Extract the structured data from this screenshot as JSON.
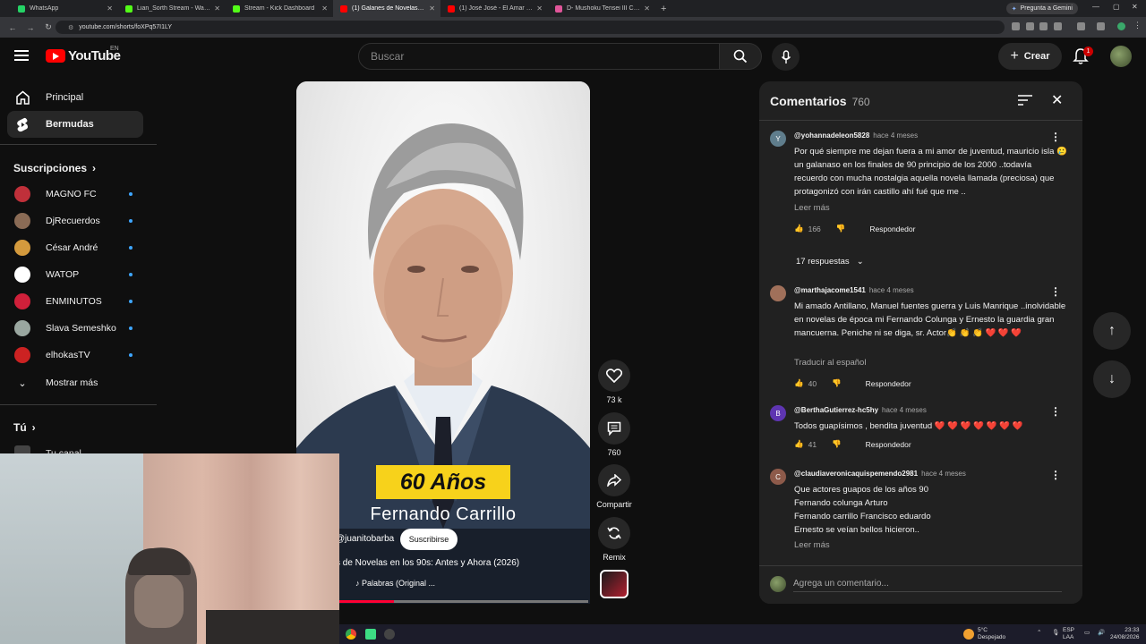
{
  "browser": {
    "tabs": [
      {
        "title": "WhatsApp",
        "color": "#25d366",
        "active": false
      },
      {
        "title": "Lian_Sorth Stream - Watch Live",
        "color": "#53fc18",
        "active": false
      },
      {
        "title": "Stream - Kick Dashboard",
        "color": "#53fc18",
        "active": false
      },
      {
        "title": "(1) Galanes de Novelas en",
        "color": "#ff0000",
        "active": true
      },
      {
        "title": "(1) José José - El Amar y el",
        "color": "#ff0000",
        "active": false
      },
      {
        "title": "D- Mushoku Tensei III Cap",
        "color": "#e05599",
        "active": false
      }
    ],
    "gemini_label": "Pregunta a Gemini",
    "url": "youtube.com/shorts/foXPq57I1LY"
  },
  "header": {
    "logo_text": "YouTube",
    "country_code": "EN",
    "search_placeholder": "Buscar",
    "create_label": "Crear",
    "notification_count": "1"
  },
  "sidebar": {
    "items": [
      {
        "label": "Principal"
      },
      {
        "label": "Bermudas"
      }
    ],
    "subscriptions_title": "Suscripciones",
    "subscriptions": [
      {
        "name": "MAGNO FC",
        "color": "#c0303a"
      },
      {
        "name": "DjRecuerdos",
        "color": "#8a6b55"
      },
      {
        "name": "César André",
        "color": "#d49a3d"
      },
      {
        "name": "WATOP",
        "color": "#ffffff"
      },
      {
        "name": "ENMINUTOS",
        "color": "#d0203a"
      },
      {
        "name": "Slava Semeshko",
        "color": "#9aa7a0"
      },
      {
        "name": "elhokasTV",
        "color": "#cc2222"
      }
    ],
    "show_more": "Mostrar más",
    "you_title": "Tú",
    "your_channel": "Tu canal"
  },
  "short": {
    "overlay_title": "60 Años",
    "overlay_name": "Fernando Carrillo",
    "channel": "@juanitobarba",
    "subscribe_label": "Suscribirse",
    "video_title": "s de Novelas en los 90s: Antes y Ahora (2026)",
    "music": "♪ Palabras (Original ...",
    "progress": 0.22
  },
  "actions": {
    "likes": "73 k",
    "comments": "760",
    "share": "Compartir",
    "remix": "Remix"
  },
  "comments_panel": {
    "title": "Comentarios",
    "count": "760",
    "comments": [
      {
        "avatar_letter": "Y",
        "avatar_color": "#5f7d8c",
        "author": "@yohannadeleon5828",
        "time": "hace 4 meses",
        "text": "Por qué siempre me dejan fuera a mi amor de juventud, mauricio isla 🥲 un galanaso en los finales de 90 principio de los 2000 ..todavía recuerdo con mucha nostalgia aquella novela llamada (preciosa) que protagonizó con irán castillo ahí fué que me ..",
        "more": "Leer más",
        "likes": "166",
        "reply": "Respondedor",
        "replies": "17 respuestas"
      },
      {
        "avatar_letter": "",
        "avatar_color": "#a0705a",
        "author": "@marthajacome1541",
        "time": "hace 4 meses",
        "text": "Mi amado Antillano, Manuel fuentes guerra y Luis Manrique ..inolvidable en novelas de época mi Fernando Colunga y Ernesto la guardia gran mancuerna. Peniche ni se diga, sr. Actor👏 👏 👏 ❤️ ❤️ ❤️",
        "more": "Traducir al español",
        "likes": "40",
        "reply": "Respondedor"
      },
      {
        "avatar_letter": "B",
        "avatar_color": "#5e35b1",
        "author": "@BerthaGutierrez-hc5hy",
        "time": "hace 4 meses",
        "text": "Todos guapísimos , bendita juventud ❤️ ❤️ ❤️ ❤️ ❤️ ❤️ ❤️",
        "likes": "41",
        "reply": "Respondedor"
      },
      {
        "avatar_letter": "C",
        "avatar_color": "#8d5a4a",
        "author": "@claudiaveronicaquispemendo2981",
        "time": "hace 4 meses",
        "text": "Que actores guapos de los años 90\nFernando colunga Arturo\nFernando carrillo Francisco eduardo\nErnesto se veían bellos hicieron..",
        "more": "Leer más"
      }
    ],
    "add_placeholder": "Agrega un comentario..."
  },
  "taskbar": {
    "weather_temp": "5°C",
    "weather_desc": "Despejado",
    "lang": "ESP",
    "lang2": "LAA",
    "time": "23:33",
    "date": "24/08/2026"
  }
}
